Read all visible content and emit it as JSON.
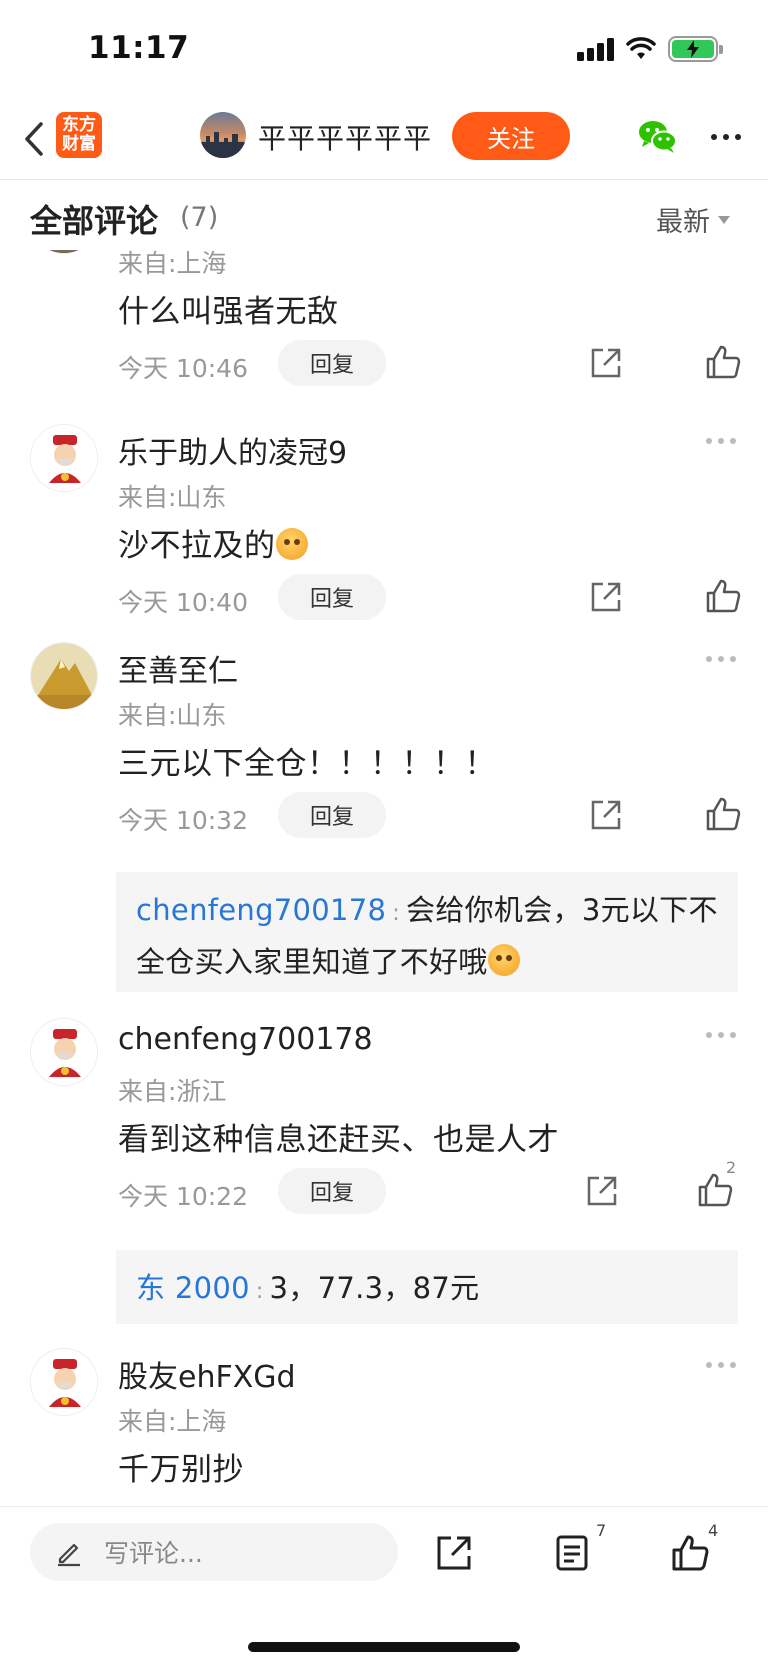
{
  "status": {
    "time": "11:17"
  },
  "header": {
    "app_logo_text": "东方财富",
    "author_name": "平平平平平平",
    "follow_label": "关注",
    "colors": {
      "accent": "#ff5a16",
      "wechat": "#2dc100"
    }
  },
  "comments_header": {
    "title": "全部评论",
    "count": "(7)",
    "sort": "最新"
  },
  "comments": [
    {
      "username": "",
      "location": "来自:上海",
      "text": "什么叫强者无敌",
      "time": "今天 10:46",
      "reply_label": "回复",
      "likes": ""
    },
    {
      "username": "乐于助人的凌冠9",
      "location": "来自:山东",
      "text": "沙不拉及的",
      "emoji": "sweat-emoji",
      "time": "今天 10:40",
      "reply_label": "回复",
      "likes": ""
    },
    {
      "username": "至善至仁",
      "location": "来自:山东",
      "text": "三元以下全仓！！！！！！",
      "time": "今天 10:32",
      "reply_label": "回复",
      "likes": "",
      "reply": {
        "author": "chenfeng700178",
        "sep": ":",
        "text": "会给你机会，3元以下不全仓买入家里知道了不好哦",
        "emoji": "sweat-emoji"
      }
    },
    {
      "username": "chenfeng700178",
      "location": "来自:浙江",
      "text": "看到这种信息还赶买、也是人才",
      "time": "今天 10:22",
      "reply_label": "回复",
      "likes": "2",
      "reply": {
        "author": "东 2000",
        "sep": ":",
        "text": "3，77.3，87元"
      }
    },
    {
      "username": "股友ehFXGd",
      "location": "来自:上海",
      "text": "千万别抄"
    }
  ],
  "bottom_bar": {
    "comment_placeholder": "写评论...",
    "comments_count": "7",
    "likes_count": "4"
  }
}
